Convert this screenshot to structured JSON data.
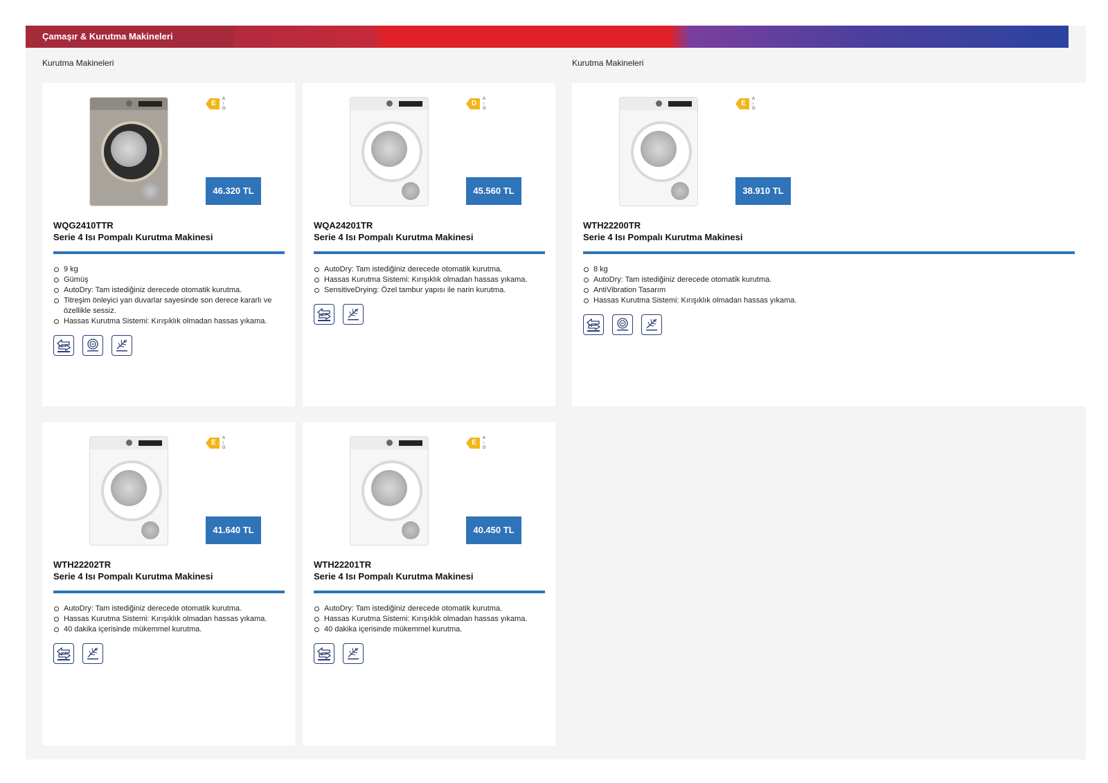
{
  "header": {
    "title": "Çamaşır & Kurutma Makineleri"
  },
  "sections": [
    {
      "label": "Kurutma Makineleri"
    },
    {
      "label": "Kurutma Makineleri"
    }
  ],
  "energy_scale": [
    "A",
    "↕",
    "G"
  ],
  "products": [
    {
      "model": "WQG2410TTR",
      "name": "Serie 4 Isı Pompalı Kurutma Makinesi",
      "price": "46.320 TL",
      "energy_class": "E",
      "color": "silver",
      "features": [
        "9 kg",
        "Gümüş",
        "AutoDry: Tam istediğiniz derecede otomatik kurutma.",
        "Titreşim önleyici yan duvarlar sayesinde son derece kararlı ve özellikle sessiz.",
        "Hassas Kurutma Sistemi: Kırışıklık olmadan hassas yıkama."
      ],
      "icons": [
        "autodry-icon",
        "antivibration-icon",
        "sensitive-drying-icon"
      ]
    },
    {
      "model": "WQA24201TR",
      "name": "Serie 4 Isı Pompalı Kurutma Makinesi",
      "price": "45.560 TL",
      "energy_class": "D",
      "color": "white",
      "features": [
        "AutoDry: Tam istediğiniz derecede otomatik kurutma.",
        "Hassas Kurutma Sistemi: Kırışıklık olmadan hassas yıkama.",
        "SensitiveDrying: Özel tambur yapısı ile narin kurutma."
      ],
      "icons": [
        "autodry-icon",
        "sensitive-drying-icon"
      ]
    },
    {
      "model": "WTH22200TR",
      "name": "Serie 4 Isı Pompalı Kurutma Makinesi",
      "price": "38.910 TL",
      "energy_class": "E",
      "color": "white",
      "features": [
        "8 kg",
        "AutoDry: Tam istediğiniz derecede otomatik kurutma.",
        "AntiVibration Tasarım",
        "Hassas Kurutma Sistemi: Kırışıklık olmadan hassas yıkama."
      ],
      "icons": [
        "autodry-icon",
        "antivibration-icon",
        "sensitive-drying-icon"
      ]
    },
    {
      "model": "WTH22202TR",
      "name": "Serie 4 Isı Pompalı Kurutma Makinesi",
      "price": "41.640 TL",
      "energy_class": "E",
      "color": "white",
      "features": [
        "AutoDry: Tam istediğiniz derecede otomatik kurutma.",
        "Hassas Kurutma Sistemi: Kırışıklık olmadan hassas yıkama.",
        "40 dakika içerisinde mükemmel kurutma."
      ],
      "icons": [
        "autodry-icon",
        "sensitive-drying-icon"
      ]
    },
    {
      "model": "WTH22201TR",
      "name": "Serie 4 Isı Pompalı Kurutma Makinesi",
      "price": "40.450 TL",
      "energy_class": "E",
      "color": "white",
      "features": [
        "AutoDry: Tam istediğiniz derecede otomatik kurutma.",
        "Hassas Kurutma Sistemi: Kırışıklık olmadan hassas yıkama.",
        "40 dakika içerisinde mükemmel kurutma."
      ],
      "icons": [
        "autodry-icon",
        "sensitive-drying-icon"
      ]
    }
  ],
  "colors": {
    "accent": "#2f73b9",
    "energy": "#f2b619",
    "sheet_bg": "#f4f4f5",
    "icon_stroke": "#2b3d73"
  }
}
